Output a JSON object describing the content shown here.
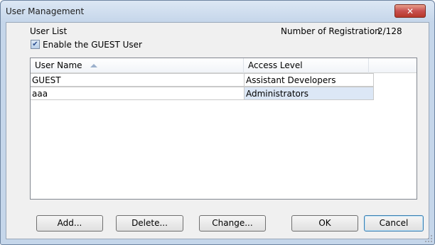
{
  "window": {
    "title": "User Management",
    "close_glyph": "✕"
  },
  "header": {
    "user_list_label": "User List",
    "registration_label": "Number of Registration",
    "registration_value": "2/128"
  },
  "guest_option": {
    "label": "Enable the GUEST User",
    "checked": true,
    "check_glyph": "✔"
  },
  "table": {
    "columns": [
      "User Name",
      "Access Level"
    ],
    "sort_icon": "sort-ascending-icon",
    "rows": [
      {
        "user": "GUEST",
        "access": "Assistant Developers"
      },
      {
        "user": "aaa",
        "access": "Administrators"
      }
    ],
    "selected_row": 1
  },
  "buttons": {
    "add": "Add...",
    "delete": "Delete...",
    "change": "Change...",
    "ok": "OK",
    "cancel": "Cancel"
  },
  "colors": {
    "frame": "#c5d6ea",
    "selection": "#dce7f6",
    "close_button": "#c75050"
  }
}
